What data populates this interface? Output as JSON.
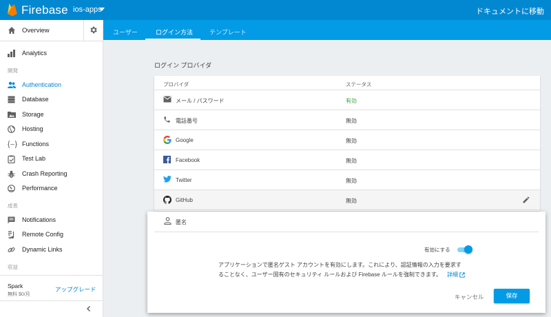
{
  "topbar": {
    "brand": "Firebase",
    "project": "ios-apps",
    "docs_link": "ドキュメントに移動"
  },
  "sidebar": {
    "overview": "Overview",
    "analytics": "Analytics",
    "section_develop": "開発",
    "develop_items": [
      {
        "label": "Authentication",
        "icon": "people-icon",
        "active": true
      },
      {
        "label": "Database",
        "icon": "database-icon"
      },
      {
        "label": "Storage",
        "icon": "storage-folder-icon"
      },
      {
        "label": "Hosting",
        "icon": "globe-icon"
      },
      {
        "label": "Functions",
        "icon": "functions-icon"
      },
      {
        "label": "Test Lab",
        "icon": "test-lab-icon"
      },
      {
        "label": "Crash Reporting",
        "icon": "bug-icon"
      },
      {
        "label": "Performance",
        "icon": "speedometer-icon"
      }
    ],
    "section_grow": "成長",
    "grow_items": [
      {
        "label": "Notifications",
        "icon": "message-icon"
      },
      {
        "label": "Remote Config",
        "icon": "remote-config-icon"
      },
      {
        "label": "Dynamic Links",
        "icon": "link-icon"
      }
    ],
    "section_earn": "収益",
    "plan": {
      "name": "Spark",
      "price": "無料 $0/月",
      "upgrade": "アップグレード"
    }
  },
  "tabs": [
    {
      "label": "ユーザー"
    },
    {
      "label": "ログイン方法",
      "active": true
    },
    {
      "label": "テンプレート"
    }
  ],
  "providers_title": "ログイン プロバイダ",
  "table": {
    "headers": {
      "provider": "プロバイダ",
      "status": "ステータス"
    },
    "rows": [
      {
        "name": "メール / パスワード",
        "status": "有効",
        "icon": "email-icon",
        "enabled": true
      },
      {
        "name": "電話番号",
        "status": "無効",
        "icon": "phone-icon"
      },
      {
        "name": "Google",
        "status": "無効",
        "icon": "google-icon"
      },
      {
        "name": "Facebook",
        "status": "無効",
        "icon": "facebook-icon"
      },
      {
        "name": "Twitter",
        "status": "無効",
        "icon": "twitter-icon"
      },
      {
        "name": "GitHub",
        "status": "無効",
        "icon": "github-icon"
      }
    ]
  },
  "dialog": {
    "provider": "匿名",
    "enable_label": "有効にする",
    "enabled": true,
    "description_line1": "アプリケーションで匿名ゲスト アカウントを有効にします。これにより、認証情報の入力を要求す",
    "description_line2": "ることなく、ユーザー固有のセキュリティ ルールおよび Firebase ルールを強制できます。",
    "details_link": "詳細",
    "cancel": "キャンセル",
    "save": "保存"
  },
  "colors": {
    "primary": "#0288d1",
    "tab_bar": "#039be5",
    "enabled_status": "#43a047"
  }
}
